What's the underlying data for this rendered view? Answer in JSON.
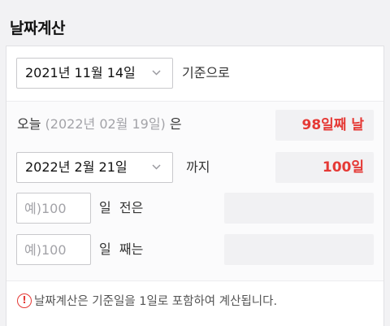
{
  "header": {
    "title": "날짜계산"
  },
  "base": {
    "date": "2021년 11월 14일",
    "suffix": "기준으로"
  },
  "today_row": {
    "prefix": "오늘",
    "date": "(2022년 02월 19일)",
    "particle": "은",
    "result": "98일째 날"
  },
  "until_row": {
    "date": "2022년 2월 21일",
    "suffix": "까지",
    "result": "100일"
  },
  "before_row": {
    "placeholder": "예)100",
    "label": "일  전은"
  },
  "nth_row": {
    "placeholder": "예)100",
    "label": "일  째는"
  },
  "notice": {
    "icon": "exclamation-icon",
    "text": "날짜계산은 기준일을 1일로 포함하여 계산됩니다."
  },
  "colors": {
    "accent_red": "#e53935",
    "background": "#f2f2f4"
  }
}
